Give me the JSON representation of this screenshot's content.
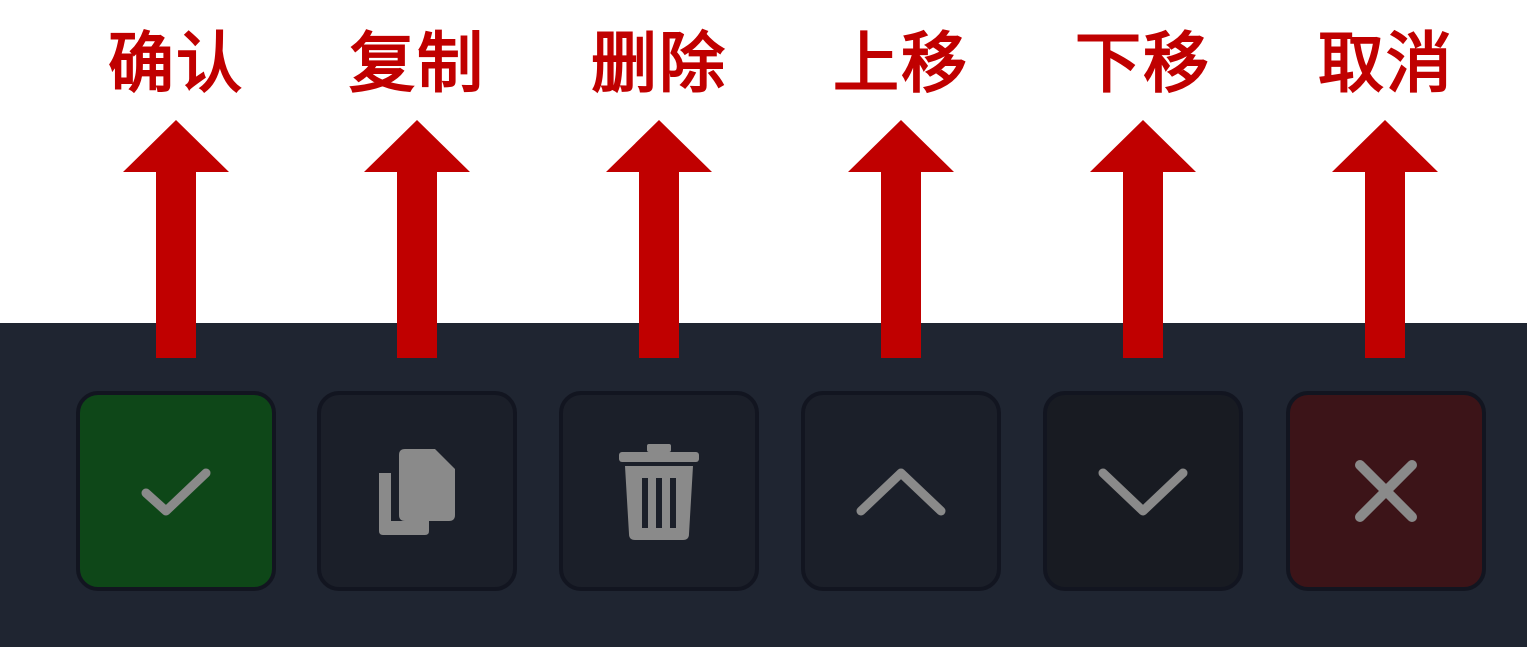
{
  "annotations": {
    "color": "#c00000",
    "labels": [
      "确认",
      "复制",
      "删除",
      "上移",
      "下移",
      "取消"
    ]
  },
  "toolbar": {
    "background": "#1f2531",
    "icon_color": "#8a8a8a",
    "buttons": [
      {
        "action": "confirm",
        "icon": "check-icon",
        "background": "#0e4718"
      },
      {
        "action": "copy",
        "icon": "copy-icon",
        "background": "#1b1f29"
      },
      {
        "action": "delete",
        "icon": "trash-icon",
        "background": "#1b1f29"
      },
      {
        "action": "move-up",
        "icon": "chevron-up-icon",
        "background": "#1b1f29"
      },
      {
        "action": "move-down",
        "icon": "chevron-down-icon",
        "background": "#181b22"
      },
      {
        "action": "cancel",
        "icon": "close-icon",
        "background": "#3c1418"
      }
    ]
  }
}
